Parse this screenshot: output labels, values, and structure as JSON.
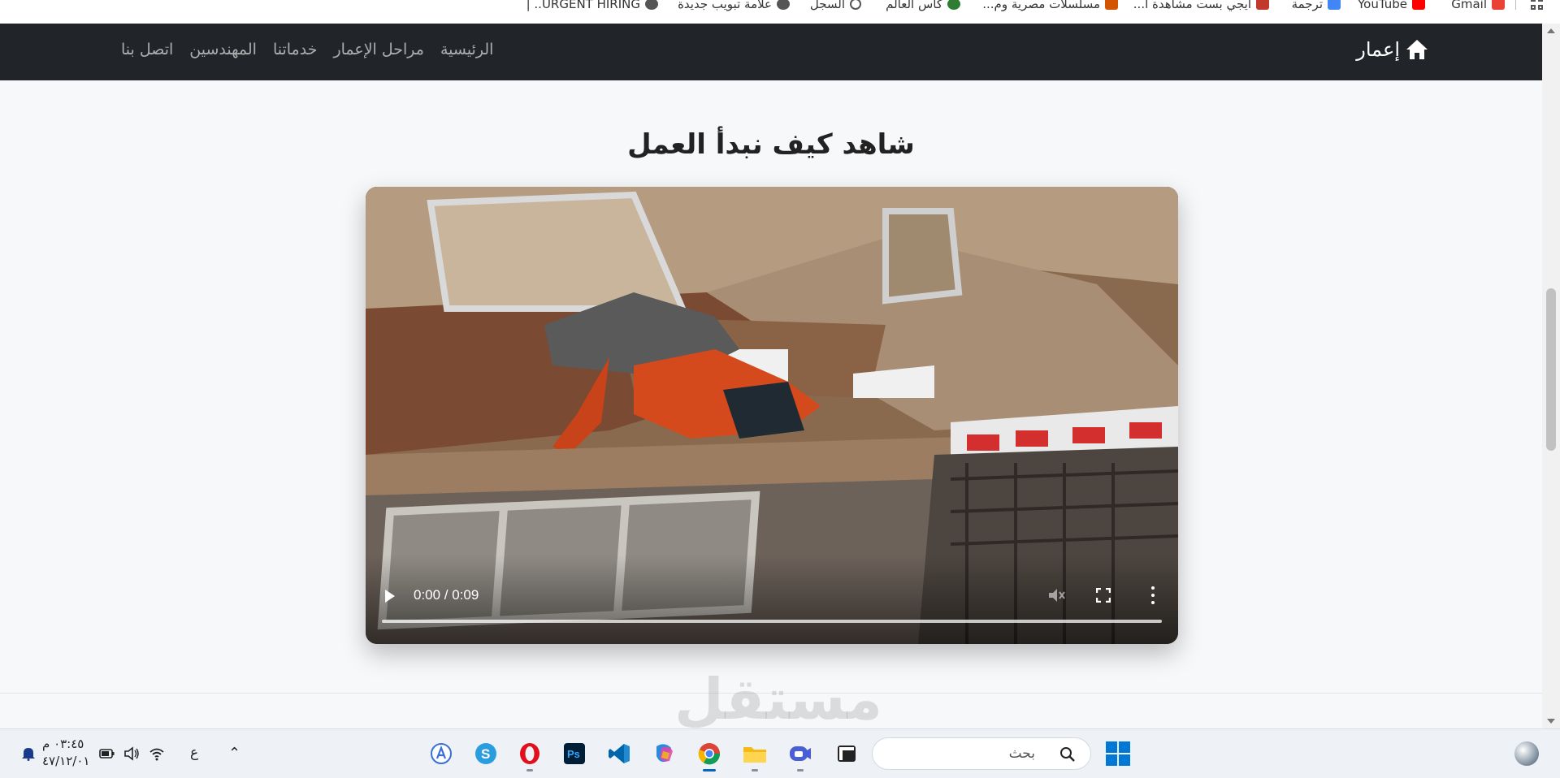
{
  "bookmarks": [
    {
      "label": "Gmail",
      "icon": "gmail-icon",
      "color": "#ea4335"
    },
    {
      "label": "YouTube",
      "icon": "youtube-icon",
      "color": "#ff0000"
    },
    {
      "label": "ترجمة",
      "icon": "translate-icon",
      "color": "#4285f4"
    },
    {
      "label": "ايجي بست مشاهدة ا...",
      "icon": "egybest-icon",
      "color": "#c0392b"
    },
    {
      "label": "مسلسلات مصرية وم...",
      "icon": "series-icon",
      "color": "#d35400"
    },
    {
      "label": "كاس العالم",
      "icon": "soccer-icon",
      "color": "#2e7d32"
    },
    {
      "label": "السجل",
      "icon": "history-icon",
      "color": "#555555"
    },
    {
      "label": "علامة تبويب جديدة",
      "icon": "globe-icon",
      "color": "#555555"
    },
    {
      "label": "URGENT HIRING.. |",
      "icon": "globe-icon",
      "color": "#555555"
    }
  ],
  "navbar": {
    "brand": "إعمار",
    "links": [
      "الرئيسية",
      "مراحل الإعمار",
      "خدماتنا",
      "المهندسين",
      "اتصل بنا"
    ]
  },
  "section": {
    "title": "شاهد كيف نبدأ العمل"
  },
  "video": {
    "time": "0:00 / 0:09",
    "progress": 0
  },
  "watermark": {
    "logo": "مستقل",
    "url": "mostaql.com"
  },
  "taskbar": {
    "search_label": "بحث",
    "apps": [
      "ai-assistant-icon",
      "skype-icon",
      "opera-icon",
      "photoshop-icon",
      "vscode-icon",
      "copilot-icon",
      "chrome-icon",
      "file-explorer-icon",
      "zoom-icon",
      "terminal-icon"
    ],
    "input_indicator": "ع",
    "clock_time": "٠٣:٤٥ م",
    "clock_date": "٤٧/١٢/٠١"
  },
  "colors": {
    "navbar_bg": "#212529",
    "page_bg": "#f7f8fa",
    "accent": "#0078d4"
  }
}
